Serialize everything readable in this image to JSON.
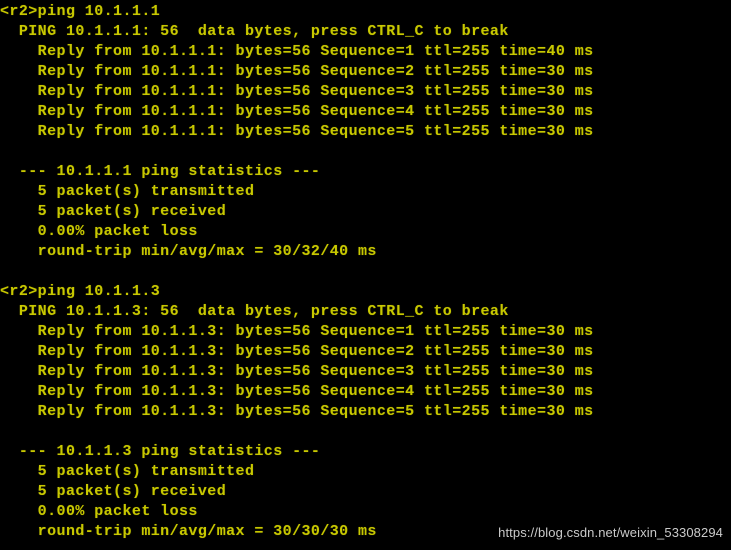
{
  "window": {
    "title": "r2 terminal console",
    "background_color": "#000000",
    "text_color": "#c8c800"
  },
  "console": {
    "lines": [
      "<r2>ping 10.1.1.1",
      "  PING 10.1.1.1: 56  data bytes, press CTRL_C to break",
      "    Reply from 10.1.1.1: bytes=56 Sequence=1 ttl=255 time=40 ms",
      "    Reply from 10.1.1.1: bytes=56 Sequence=2 ttl=255 time=30 ms",
      "    Reply from 10.1.1.1: bytes=56 Sequence=3 ttl=255 time=30 ms",
      "    Reply from 10.1.1.1: bytes=56 Sequence=4 ttl=255 time=30 ms",
      "    Reply from 10.1.1.1: bytes=56 Sequence=5 ttl=255 time=30 ms",
      "",
      "  --- 10.1.1.1 ping statistics ---",
      "    5 packet(s) transmitted",
      "    5 packet(s) received",
      "    0.00% packet loss",
      "    round-trip min/avg/max = 30/32/40 ms",
      "",
      "<r2>ping 10.1.1.3",
      "  PING 10.1.1.3: 56  data bytes, press CTRL_C to break",
      "    Reply from 10.1.1.3: bytes=56 Sequence=1 ttl=255 time=30 ms",
      "    Reply from 10.1.1.3: bytes=56 Sequence=2 ttl=255 time=30 ms",
      "    Reply from 10.1.1.3: bytes=56 Sequence=3 ttl=255 time=30 ms",
      "    Reply from 10.1.1.3: bytes=56 Sequence=4 ttl=255 time=30 ms",
      "    Reply from 10.1.1.3: bytes=56 Sequence=5 ttl=255 time=30 ms",
      "",
      "  --- 10.1.1.3 ping statistics ---",
      "    5 packet(s) transmitted",
      "    5 packet(s) received",
      "    0.00% packet loss",
      "    round-trip min/avg/max = 30/30/30 ms"
    ],
    "sessions": [
      {
        "prompt": "<r2>",
        "command": "ping 10.1.1.1",
        "header": "  PING 10.1.1.1: 56  data bytes, press CTRL_C to break",
        "replies": [
          {
            "host": "10.1.1.1",
            "bytes": "56",
            "sequence": "1",
            "ttl": "255",
            "time": "40",
            "unit": "ms"
          },
          {
            "host": "10.1.1.1",
            "bytes": "56",
            "sequence": "2",
            "ttl": "255",
            "time": "30",
            "unit": "ms"
          },
          {
            "host": "10.1.1.1",
            "bytes": "56",
            "sequence": "3",
            "ttl": "255",
            "time": "30",
            "unit": "ms"
          },
          {
            "host": "10.1.1.1",
            "bytes": "56",
            "sequence": "4",
            "ttl": "255",
            "time": "30",
            "unit": "ms"
          },
          {
            "host": "10.1.1.1",
            "bytes": "56",
            "sequence": "5",
            "ttl": "255",
            "time": "30",
            "unit": "ms"
          }
        ],
        "statistics": {
          "header": "  --- 10.1.1.1 ping statistics ---",
          "transmitted": "    5 packet(s) transmitted",
          "received": "    5 packet(s) received",
          "loss": "    0.00% packet loss",
          "round_trip": "    round-trip min/avg/max = 30/32/40 ms"
        }
      },
      {
        "prompt": "<r2>",
        "command": "ping 10.1.1.3",
        "header": "  PING 10.1.1.3: 56  data bytes, press CTRL_C to break",
        "replies": [
          {
            "host": "10.1.1.3",
            "bytes": "56",
            "sequence": "1",
            "ttl": "255",
            "time": "30",
            "unit": "ms"
          },
          {
            "host": "10.1.1.3",
            "bytes": "56",
            "sequence": "2",
            "ttl": "255",
            "time": "30",
            "unit": "ms"
          },
          {
            "host": "10.1.1.3",
            "bytes": "56",
            "sequence": "3",
            "ttl": "255",
            "time": "30",
            "unit": "ms"
          },
          {
            "host": "10.1.1.3",
            "bytes": "56",
            "sequence": "4",
            "ttl": "255",
            "time": "30",
            "unit": "ms"
          },
          {
            "host": "10.1.1.3",
            "bytes": "56",
            "sequence": "5",
            "ttl": "255",
            "time": "30",
            "unit": "ms"
          }
        ],
        "statistics": {
          "header": "  --- 10.1.1.3 ping statistics ---",
          "transmitted": "    5 packet(s) transmitted",
          "received": "    5 packet(s) received",
          "loss": "    0.00% packet loss",
          "round_trip": "    round-trip min/avg/max = 30/30/30 ms"
        }
      }
    ]
  },
  "watermark": {
    "text": "https://blog.csdn.net/weixin_53308294",
    "color": "#dcdcdc"
  }
}
